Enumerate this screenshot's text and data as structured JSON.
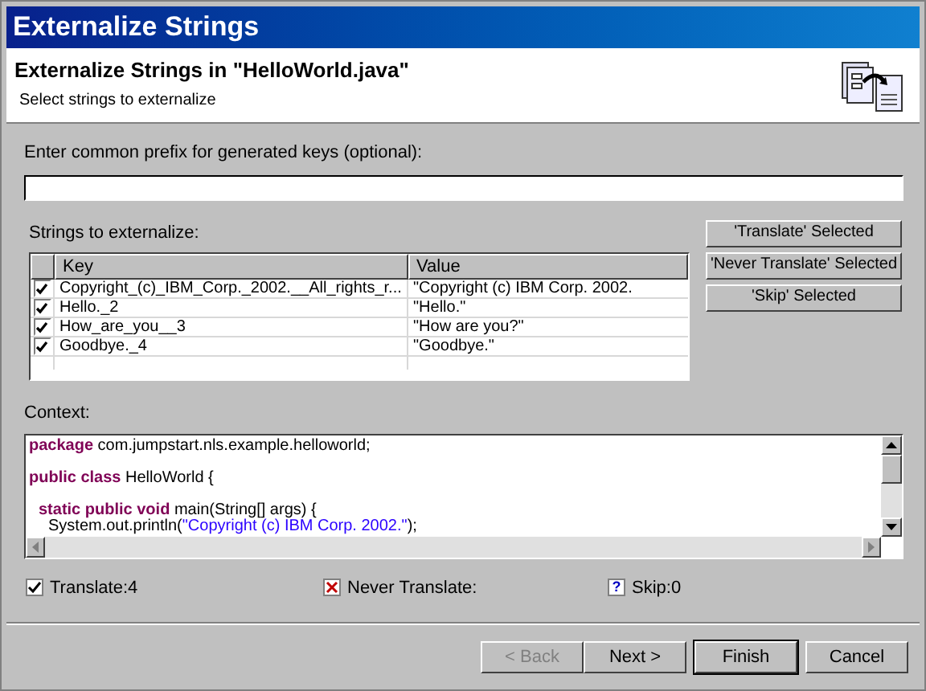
{
  "window": {
    "title": "Externalize Strings"
  },
  "header": {
    "title": "Externalize Strings in \"HelloWorld.java\"",
    "subtitle": "Select strings to externalize"
  },
  "prefix": {
    "label": "Enter common prefix for generated keys (optional):"
  },
  "strings": {
    "label": "Strings to externalize:",
    "columns": [
      "Key",
      "Value"
    ],
    "rows": [
      {
        "checked": true,
        "key": "Copyright_(c)_IBM_Corp._2002.__All_rights_r...",
        "value": "\"Copyright (c) IBM Corp. 2002."
      },
      {
        "checked": true,
        "key": "Hello._2",
        "value": "\"Hello.\""
      },
      {
        "checked": true,
        "key": "How_are_you__3",
        "value": "\"How are you?\""
      },
      {
        "checked": true,
        "key": "Goodbye._4",
        "value": "\"Goodbye.\""
      }
    ]
  },
  "actions": [
    "'Translate' Selected",
    "'Never Translate' Selected",
    "'Skip' Selected"
  ],
  "context": {
    "label": "Context:",
    "lines": [
      {
        "kind": "code",
        "segments": [
          {
            "kind": "keyword",
            "text": "package"
          },
          {
            "kind": "plain",
            "text": " com.jumpstart.nls.example.helloworld;"
          }
        ]
      },
      {
        "kind": "blank"
      },
      {
        "kind": "code",
        "segments": [
          {
            "kind": "keyword",
            "text": "public class"
          },
          {
            "kind": "plain",
            "text": " HelloWorld {"
          }
        ]
      },
      {
        "kind": "blank"
      },
      {
        "kind": "indent1",
        "segments": [
          {
            "kind": "keyword",
            "text": "static public void"
          },
          {
            "kind": "plain",
            "text": " main(String[] args) {"
          }
        ]
      },
      {
        "kind": "indent2",
        "segments": [
          {
            "kind": "plain",
            "text": "System.out.println("
          },
          {
            "kind": "string",
            "text": "\"Copyright (c) IBM Corp. 2002.\""
          },
          {
            "kind": "plain",
            "text": ");"
          }
        ]
      }
    ]
  },
  "summary": [
    {
      "kind": "translate",
      "text": "Translate:4"
    },
    {
      "kind": "never",
      "text": "Never Translate:"
    },
    {
      "kind": "skip",
      "icon": "?",
      "text": "Skip:0"
    }
  ],
  "buttons": [
    {
      "label": "< Back",
      "disabled": true,
      "default": false
    },
    {
      "label": "Next >",
      "disabled": false,
      "default": false
    },
    {
      "label": "Finish",
      "disabled": false,
      "default": true
    },
    {
      "label": "Cancel",
      "disabled": false,
      "default": false
    }
  ]
}
